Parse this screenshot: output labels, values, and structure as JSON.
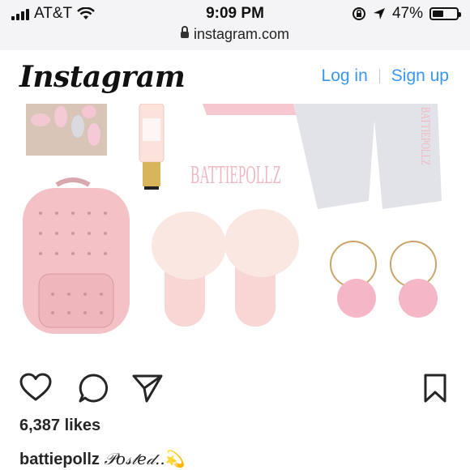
{
  "status_bar": {
    "carrier": "AT&T",
    "time": "9:09 PM",
    "battery_percent": "47%",
    "battery_level": 0.47,
    "url": "instagram.com"
  },
  "header": {
    "logo": "Instagram",
    "login_label": "Log in",
    "signup_label": "Sign up"
  },
  "post": {
    "image_watermark": "BATTIEPOLLZ",
    "shorts_print": "BATTIEPOLLZ",
    "likes": "6,387 likes",
    "caption_user": "battiepollz",
    "caption_text": "𝒫𝑜𝓈𝓉𝑒𝒹..",
    "caption_emoji": "💫"
  }
}
